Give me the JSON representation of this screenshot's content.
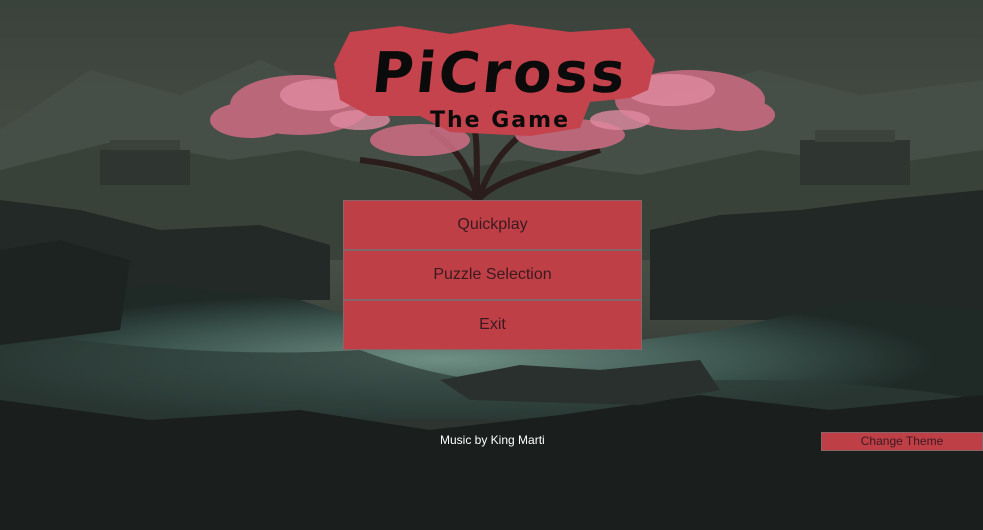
{
  "logo": {
    "title": "PiCross",
    "subtitle": "The Game"
  },
  "menu": {
    "items": [
      {
        "label": "Quickplay"
      },
      {
        "label": "Puzzle Selection"
      },
      {
        "label": "Exit"
      }
    ]
  },
  "footer": {
    "credit": "Music by King Marti",
    "theme_button": "Change Theme"
  },
  "colors": {
    "accent": "#bf3f47",
    "button_text": "#3a1a1f",
    "blossom": "#d06a85"
  }
}
